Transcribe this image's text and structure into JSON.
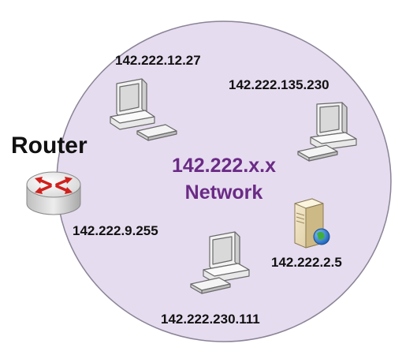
{
  "colors": {
    "network_fill": "#e6dcef",
    "network_stroke": "#8a8396",
    "network_text": "#6b2b86",
    "label_text": "#111111"
  },
  "router": {
    "title": "Router",
    "ip": "142.222.9.255",
    "icon": "router-icon"
  },
  "network": {
    "line1": "142.222.x.x",
    "line2": "Network"
  },
  "devices": [
    {
      "type": "workstation",
      "icon": "desktop-computer-icon",
      "ip": "142.222.12.27"
    },
    {
      "type": "workstation",
      "icon": "desktop-computer-icon",
      "ip": "142.222.135.230"
    },
    {
      "type": "server",
      "icon": "web-server-icon",
      "ip": "142.222.2.5"
    },
    {
      "type": "workstation",
      "icon": "desktop-computer-icon",
      "ip": "142.222.230.111"
    }
  ]
}
